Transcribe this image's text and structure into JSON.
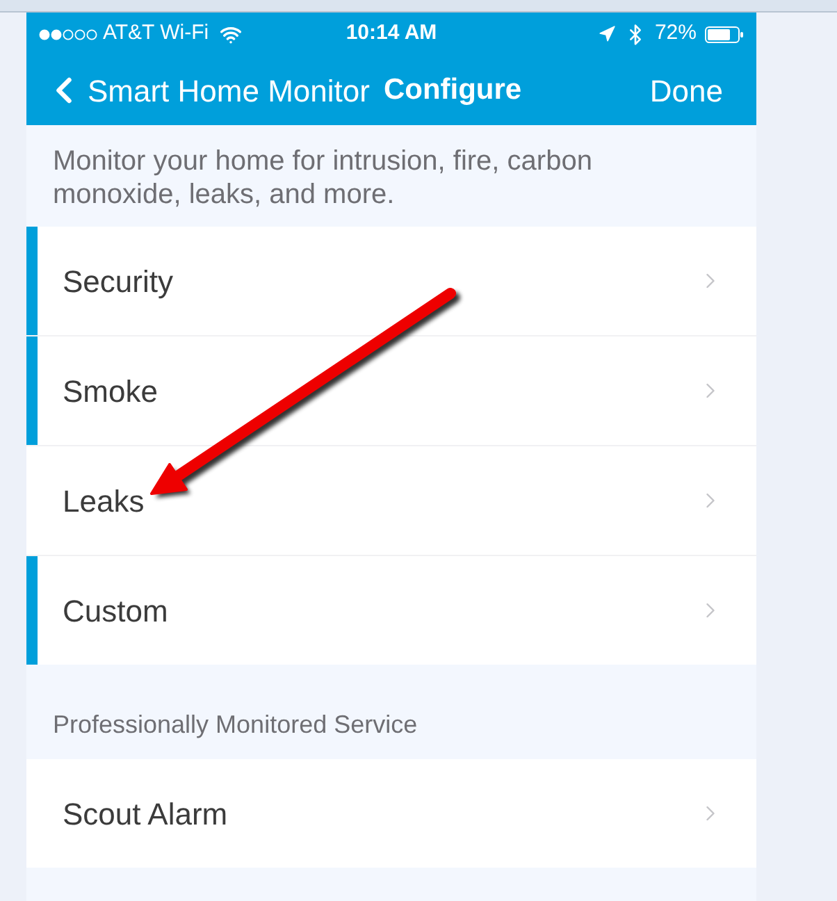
{
  "status_bar": {
    "carrier": "AT&T Wi-Fi",
    "time": "10:14 AM",
    "battery": "72%"
  },
  "nav_bar": {
    "back_label": "Smart Home Monitor",
    "title": "Configure",
    "action": "Done"
  },
  "description": "Monitor your home for intrusion, fire, carbon monoxide, leaks, and more.",
  "modes": [
    {
      "label": "Security",
      "active": true
    },
    {
      "label": "Smoke",
      "active": true
    },
    {
      "label": "Leaks",
      "active": false
    },
    {
      "label": "Custom",
      "active": true
    }
  ],
  "section_header": "Professionally Monitored Service",
  "services": [
    {
      "label": "Scout Alarm",
      "active": false
    }
  ]
}
